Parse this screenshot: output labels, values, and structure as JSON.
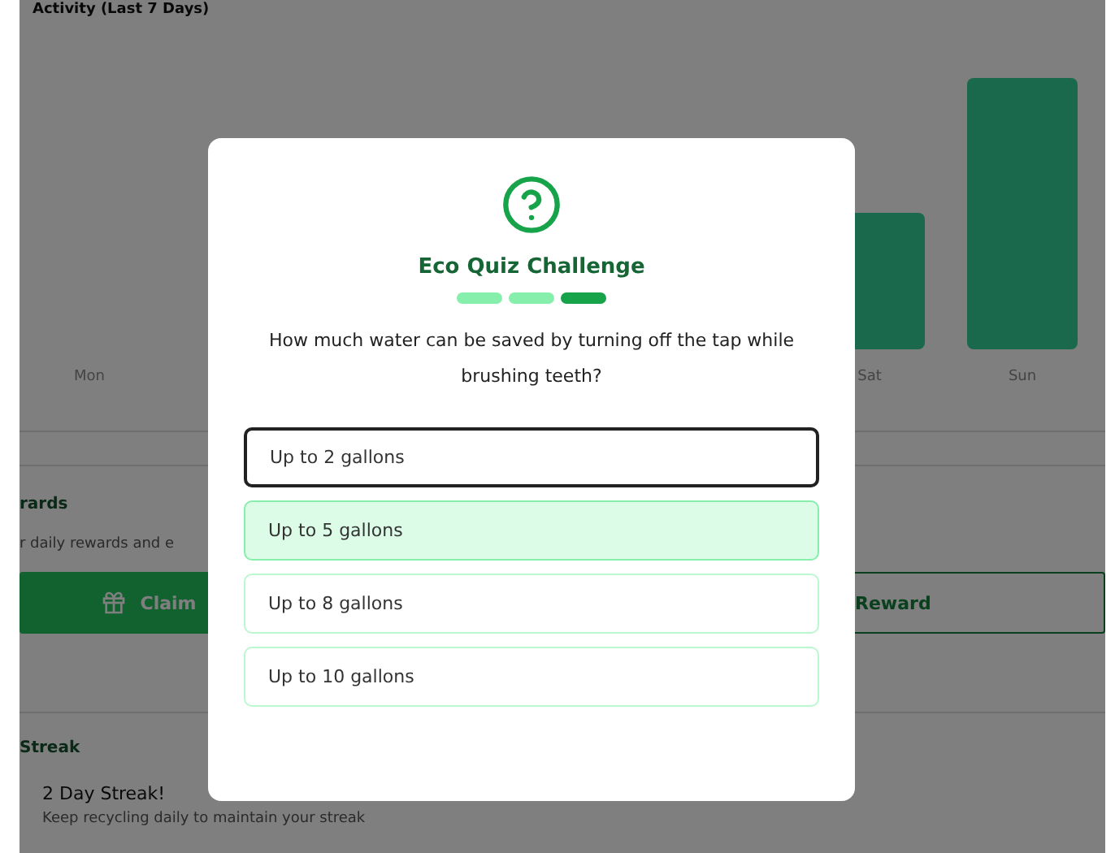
{
  "activity": {
    "title": "Activity (Last 7 Days)",
    "days": [
      {
        "label": "Mon"
      },
      {
        "label": "Sat"
      },
      {
        "label": "Sun"
      }
    ]
  },
  "rewards": {
    "title": "rards",
    "subtitle": "r daily rewards and e",
    "buttons": [
      {
        "label": "Claim",
        "kind": "primary"
      },
      {
        "label": "Reward",
        "kind": "outline"
      }
    ]
  },
  "streak": {
    "title": "Streak",
    "headline": "2 Day Streak!",
    "subtitle": "Keep recycling daily to maintain your streak"
  },
  "quiz": {
    "title": "Eco Quiz Challenge",
    "steps": [
      {
        "current": false
      },
      {
        "current": false
      },
      {
        "current": true
      }
    ],
    "question": "How much water can be saved by turning off the tap while brushing teeth?",
    "options": [
      {
        "label": "Up to 2 gallons",
        "selected": true,
        "hovered": false
      },
      {
        "label": "Up to 5 gallons",
        "selected": false,
        "hovered": true
      },
      {
        "label": "Up to 8 gallons",
        "selected": false,
        "hovered": false
      },
      {
        "label": "Up to 10 gallons",
        "selected": false,
        "hovered": false
      }
    ]
  }
}
